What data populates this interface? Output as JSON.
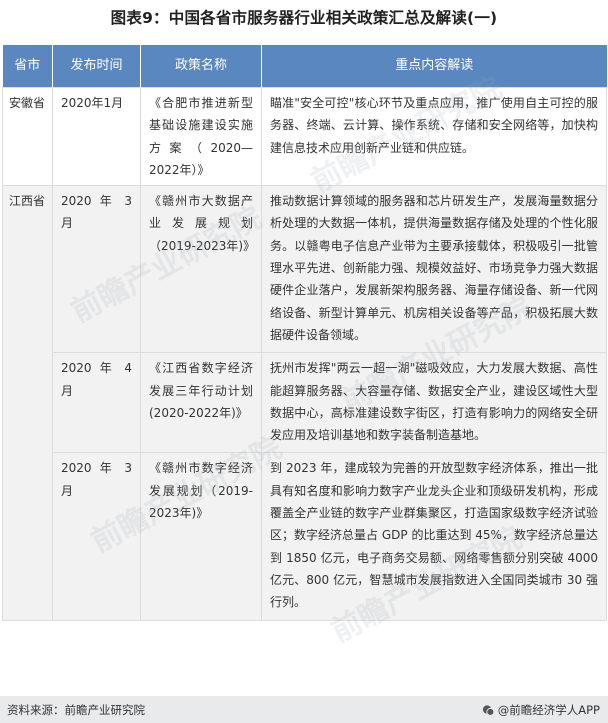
{
  "title": "图表9：中国各省市服务器行业相关政策汇总及解读(一)",
  "table": {
    "headers": [
      "省市",
      "发布时间",
      "政策名称",
      "重点内容解读"
    ],
    "rows": [
      {
        "province": "安徽省",
        "date": "2020年1月",
        "policy": "《合肥市推进新型基础设施建设实施方案（2020—2022年）》",
        "content": "瞄准\"安全可控\"核心环节及重点应用，推广使用自主可控的服务器、终端、云计算、操作系统、存储和安全网络等，加快构建信息技术应用创新产业链和供应链。"
      },
      {
        "province": "江西省",
        "date": "2020 年 3 月",
        "policy": "《赣州市大数据产业发展规划（2019-2023年)》",
        "content": "推动数据计算领域的服务器和芯片研发生产，发展海量数据分析处理的大数据一体机，提供海量数据存储及处理的个性化服务。以赣粤电子信息产业带为主要承接载体，积极吸引一批管理水平先进、创新能力强、规模效益好、市场竞争力强大数据硬件企业落户，发展新架构服务器、海量存储设备、新一代网络设备、新型计算单元、机房相关设备等产品，积极拓展大数据硬件设备领域。"
      },
      {
        "province": "",
        "date": "2020 年 4 月",
        "policy": "《江西省数字经济发展三年行动计划(2020-2022年)》",
        "content": "抚州市发挥\"两云一超一湖\"磁吸效应，大力发展大数据、高性能超算服务器、大容量存储、数据安全产业，建设区域性大型数据中心，高标准建设数字街区，打造有影响力的网络安全研发应用及培训基地和数字装备制造基地。"
      },
      {
        "province": "",
        "date": "2020 年 3 月",
        "policy": "《赣州市数字经济发展规划（2019-2023年)》",
        "content": "到 2023 年，建成较为完善的开放型数字经济体系，推出一批具有知名度和影响力数字产业龙头企业和顶级研发机构，形成覆盖全产业链的数字产业群集聚区，打造国家级数字经济试验区；数字经济总量占 GDP 的比重达到 45%，数字经济总量达到 1850 亿元，电子商务交易额、网络零售额分别突破 4000 亿元、800 亿元，智慧城市发展指数进入全国同类城市 30 强行列。"
      }
    ]
  },
  "footer": {
    "source": "资料来源：前瞻产业研究院",
    "brand": "@前瞻经济学人APP"
  },
  "watermark_text": "前瞻产业研究院",
  "colors": {
    "header_bg": "#5a87c0",
    "row_alt_bg": "#f2f2f2",
    "footer_bg": "#e9eaec"
  }
}
